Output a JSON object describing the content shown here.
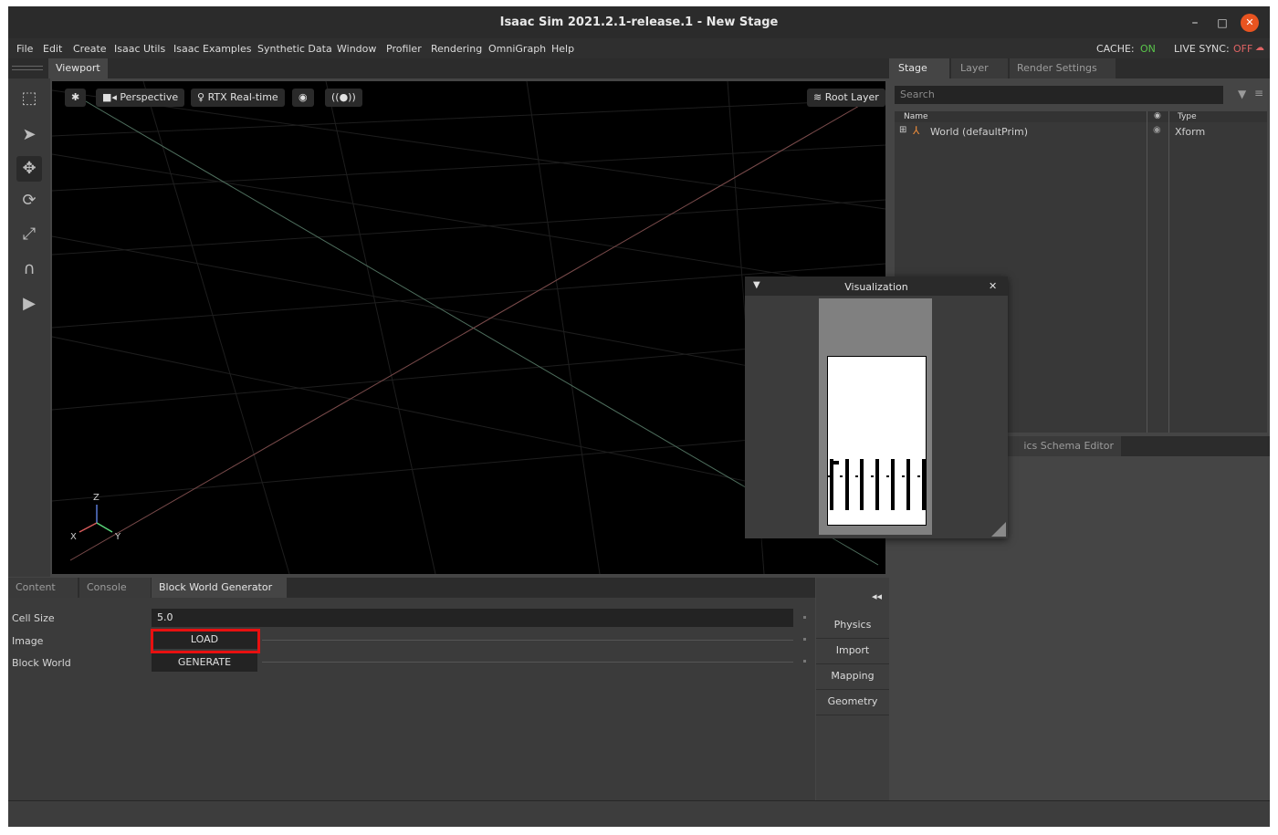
{
  "window": {
    "title": "Isaac Sim 2021.2.1-release.1 - New Stage",
    "minimize": "–",
    "maximize": "□",
    "close": "✕"
  },
  "menu": {
    "items": [
      "File",
      "Edit",
      "Create",
      "Isaac Utils",
      "Isaac Examples",
      "Synthetic Data",
      "Window",
      "Profiler",
      "Rendering",
      "OmniGraph",
      "Help"
    ],
    "cache_label": "CACHE:",
    "cache_value": "ON",
    "live_sync_label": "LIVE SYNC:",
    "live_sync_value": "OFF"
  },
  "viewport": {
    "tab_label": "Viewport",
    "camera_label": "Perspective",
    "renderer_label": "RTX Real-time",
    "layer_label": "Root Layer",
    "broadcast_label": "((●))",
    "axis_z": "Z",
    "axis_x": "X",
    "axis_y": "Y"
  },
  "bottom_panel": {
    "tabs": [
      "Content",
      "Console",
      "Block World Generator"
    ],
    "active_tab": 2,
    "rows": {
      "cell_size_label": "Cell Size",
      "cell_size_value": "5.0",
      "image_label": "Image",
      "load_button": "LOAD",
      "block_world_label": "Block World",
      "generate_button": "GENERATE"
    }
  },
  "side_tools": {
    "collapse": "◂◂",
    "items": [
      "Physics",
      "Import",
      "Mapping",
      "Geometry"
    ]
  },
  "stage": {
    "tabs": [
      "Stage",
      "Layer",
      "Render Settings"
    ],
    "search_placeholder": "Search",
    "columns": {
      "name": "Name",
      "type": "Type"
    },
    "rows": [
      {
        "name": "World (defaultPrim)",
        "type": "Xform"
      }
    ]
  },
  "properties": {
    "tab_label": "ics Schema Editor"
  },
  "visualization": {
    "title": "Visualization",
    "close": "✕",
    "collapse": "▼"
  },
  "colors": {
    "accent_on": "#59c54a",
    "accent_off": "#e06464",
    "highlight": "#e81010"
  }
}
